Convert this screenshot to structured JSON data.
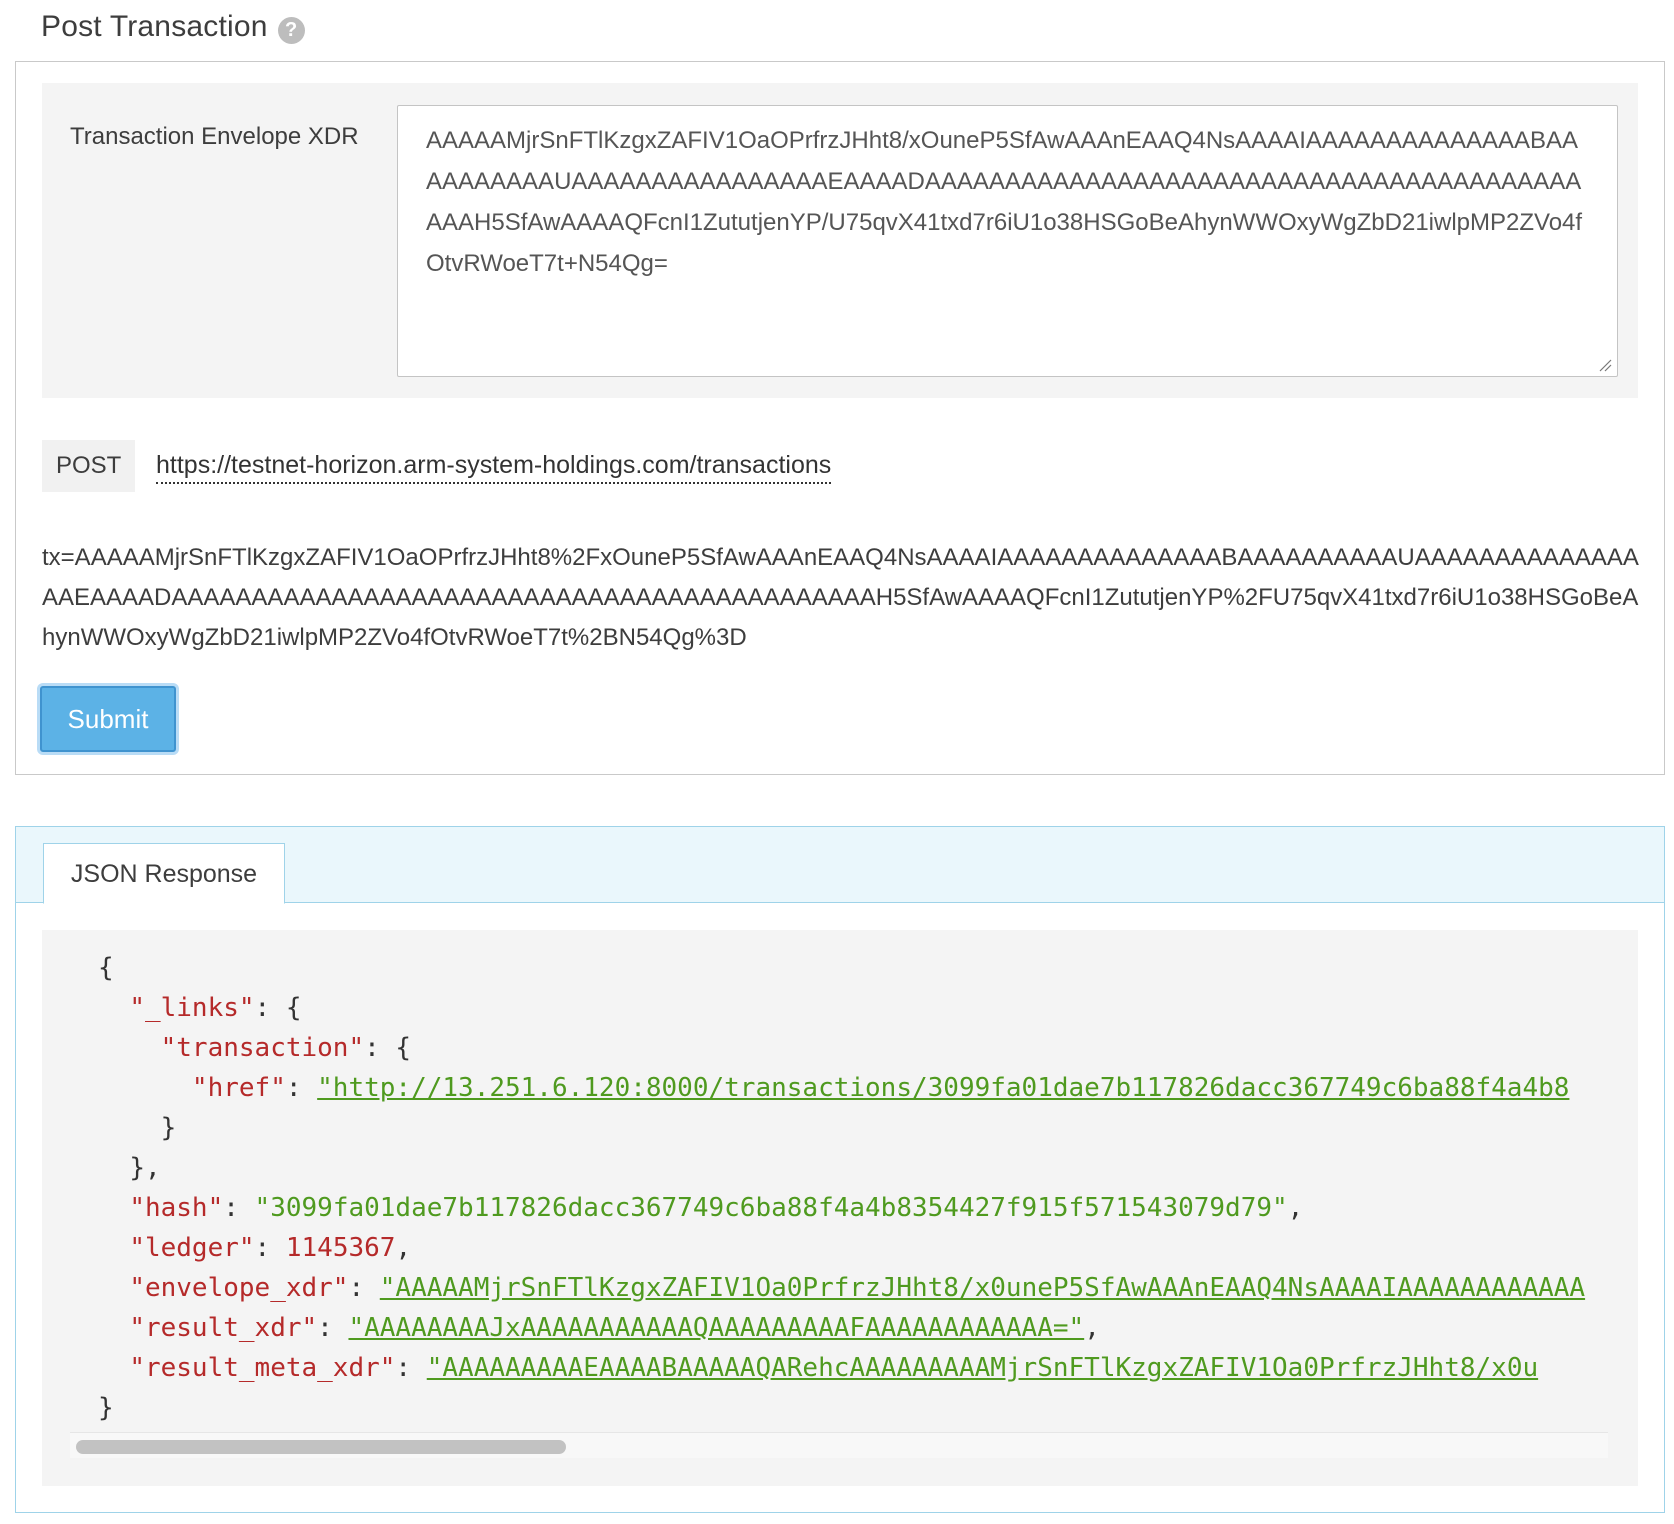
{
  "header": {
    "title": "Post Transaction",
    "help_icon": "?"
  },
  "envelope": {
    "label": "Transaction Envelope XDR",
    "value": "AAAAAMjrSnFTlKzgxZAFIV1OaOPrfrzJHht8/xOuneP5SfAwAAAnEAAQ4NsAAAAIAAAAAAAAAAAAAABAAAAAAAAAAUAAAAAAAAAAAAAAAAEAAAADAAAAAAAAAAAAAAAAAAAAAAAAAAAAAAAAAAAAAAAAAAAAH5SfAwAAAAQFcnI1ZututjenYP/U75qvX41txd7r6iU1o38HSGoBeAhynWWOxyWgZbD21iwlpMP2ZVo4fOtvRWoeT7t+N54Qg="
  },
  "request": {
    "method": "POST",
    "url": "https://testnet-horizon.arm-system-holdings.com/transactions",
    "body": "tx=AAAAAMjrSnFTlKzgxZAFIV1OaOPrfrzJHht8%2FxOuneP5SfAwAAAnEAAQ4NsAAAAIAAAAAAAAAAAAAABAAAAAAAAAAUAAAAAAAAAAAAAAAAEAAAADAAAAAAAAAAAAAAAAAAAAAAAAAAAAAAAAAAAAAAAAAAAAH5SfAwAAAAQFcnI1ZututjenYP%2FU75qvX41txd7r6iU1o38HSGoBeAhynWWOxyWgZbD21iwlpMP2ZVo4fOtvRWoeT7t%2BN54Qg%3D"
  },
  "actions": {
    "submit_label": "Submit"
  },
  "response": {
    "tab_label": "JSON Response",
    "punct": {
      "open_brace": "{",
      "close_brace": "}",
      "close_brace_comma": "},",
      "colon": ": ",
      "colon_brace": ": {",
      "comma": ","
    },
    "keys": {
      "links": "\"_links\"",
      "transaction": "\"transaction\"",
      "href": "\"href\"",
      "hash": "\"hash\"",
      "ledger": "\"ledger\"",
      "envelope_xdr": "\"envelope_xdr\"",
      "result_xdr": "\"result_xdr\"",
      "result_meta_xdr": "\"result_meta_xdr\""
    },
    "values": {
      "href": "\"http://13.251.6.120:8000/transactions/3099fa01dae7b117826dacc367749c6ba88f4a4b8",
      "hash": "\"3099fa01dae7b117826dacc367749c6ba88f4a4b8354427f915f571543079d79\"",
      "ledger": "1145367",
      "envelope_xdr": "\"AAAAAMjrSnFTlKzgxZAFIV1Oa0PrfrzJHht8/x0uneP5SfAwAAAnEAAQ4NsAAAAIAAAAAAAAAAAA",
      "result_xdr": "\"AAAAAAAAJxAAAAAAAAAAAQAAAAAAAAAFAAAAAAAAAAAA=\"",
      "result_meta_xdr": "\"AAAAAAAAAEAAAABAAAAAQARehcAAAAAAAAAMjrSnFTlKzgxZAFIV1Oa0PrfrzJHht8/x0u"
    }
  },
  "colors": {
    "accent_button": "#5cb2e6",
    "json_key": "#b52a2a",
    "json_string": "#4f9a1f",
    "tab_strip": "#eaf7fc"
  },
  "icons": {
    "help": "help-icon",
    "resize": "resize-grip-icon"
  }
}
